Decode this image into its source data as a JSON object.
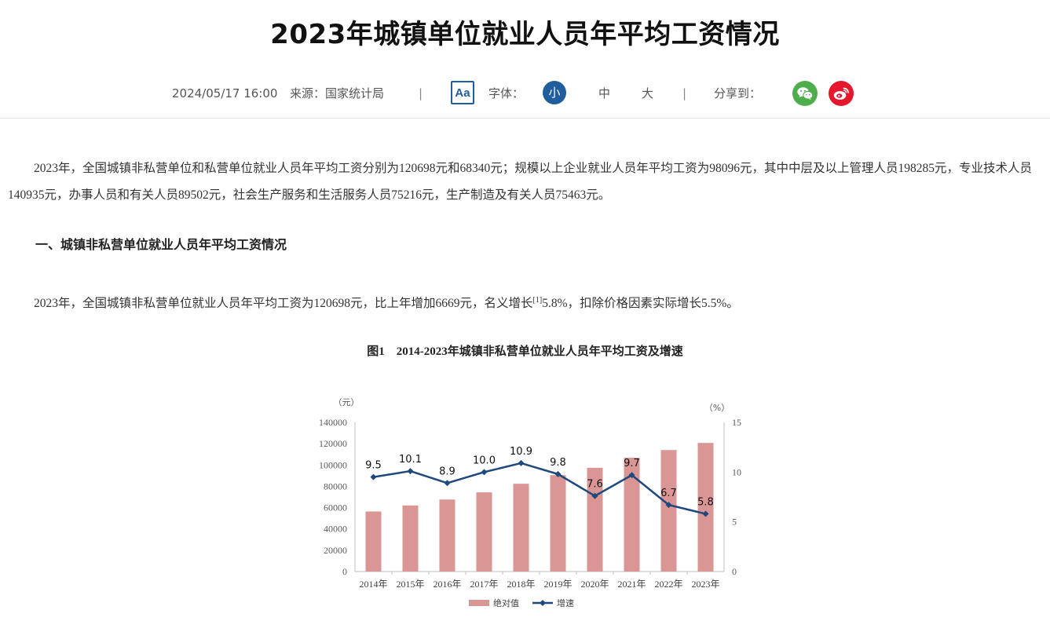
{
  "article": {
    "title": "2023年城镇单位就业人员年平均工资情况",
    "date": "2024/05/17 16:00",
    "source": "来源：国家统计局",
    "separator": "|",
    "font_label": "字体：",
    "font_toggle_label": "Aa",
    "font_sizes": [
      "小",
      "中",
      "大"
    ],
    "share_label": "分享到："
  },
  "share": {
    "wechat_color": "#4fae4c",
    "weibo_color": "#e6162d"
  },
  "content": {
    "para1": "2023年，全国城镇非私营单位和私营单位就业人员年平均工资分别为120698元和68340元；规模以上企业就业人员年平均工资为98096元，其中中层及以上管理人员198285元，专业技术人员140935元，办事人员和有关人员89502元，社会生产服务和生活服务人员75216元，生产制造及有关人员75463元。",
    "heading1": "一、城镇非私营单位就业人员年平均工资情况",
    "para2_before": "2023年，全国城镇非私营单位就业人员年平均工资为120698元，比上年增加6669元，名义增长",
    "para2_note": "[1]",
    "para2_after": "5.8%，扣除价格因素实际增长5.5%。",
    "figure_caption": "图1　2014-2023年城镇非私营单位就业人员年平均工资及增速"
  },
  "chart_data": {
    "type": "bar",
    "categories": [
      "2014年",
      "2015年",
      "2016年",
      "2017年",
      "2018年",
      "2019年",
      "2020年",
      "2021年",
      "2022年",
      "2023年"
    ],
    "series": [
      {
        "name": "绝对值",
        "type": "bar",
        "axis": "left",
        "color": "#d99694",
        "values": [
          56360,
          62029,
          67569,
          74318,
          82413,
          90501,
          97379,
          106837,
          114029,
          120698
        ]
      },
      {
        "name": "增速",
        "type": "line",
        "axis": "right",
        "color": "#1f497d",
        "values": [
          9.5,
          10.1,
          8.9,
          10.0,
          10.9,
          9.8,
          7.6,
          9.7,
          6.7,
          5.8
        ],
        "labels": [
          "9.5",
          "10.1",
          "8.9",
          "10.0",
          "10.9",
          "9.8",
          "7.6",
          "9.7",
          "6.7",
          "5.8"
        ]
      }
    ],
    "left_unit": "（元）",
    "right_unit": "（%）",
    "left_ticks": [
      0,
      20000,
      40000,
      60000,
      80000,
      100000,
      120000,
      140000
    ],
    "right_ticks": [
      0,
      5,
      10,
      15
    ],
    "ylim_left": [
      0,
      140000
    ],
    "ylim_right": [
      0,
      15
    ],
    "grid": false,
    "legend_position": "bottom"
  }
}
